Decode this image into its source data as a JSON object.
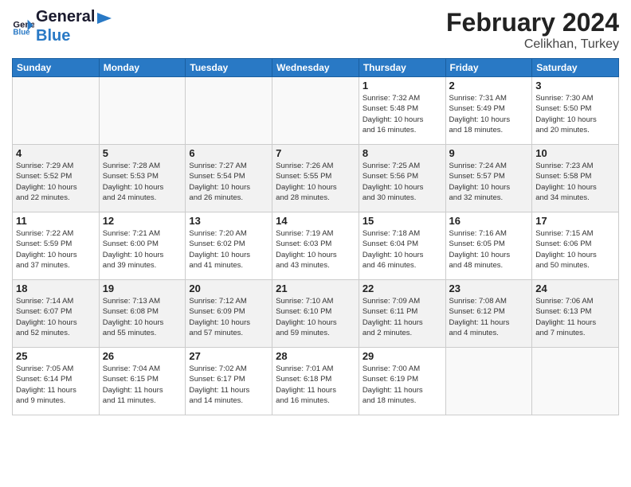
{
  "header": {
    "logo_text_general": "General",
    "logo_text_blue": "Blue",
    "month_title": "February 2024",
    "location": "Celikhan, Turkey"
  },
  "weekdays": [
    "Sunday",
    "Monday",
    "Tuesday",
    "Wednesday",
    "Thursday",
    "Friday",
    "Saturday"
  ],
  "weeks": [
    [
      {
        "day": "",
        "info": ""
      },
      {
        "day": "",
        "info": ""
      },
      {
        "day": "",
        "info": ""
      },
      {
        "day": "",
        "info": ""
      },
      {
        "day": "1",
        "info": "Sunrise: 7:32 AM\nSunset: 5:48 PM\nDaylight: 10 hours\nand 16 minutes."
      },
      {
        "day": "2",
        "info": "Sunrise: 7:31 AM\nSunset: 5:49 PM\nDaylight: 10 hours\nand 18 minutes."
      },
      {
        "day": "3",
        "info": "Sunrise: 7:30 AM\nSunset: 5:50 PM\nDaylight: 10 hours\nand 20 minutes."
      }
    ],
    [
      {
        "day": "4",
        "info": "Sunrise: 7:29 AM\nSunset: 5:52 PM\nDaylight: 10 hours\nand 22 minutes."
      },
      {
        "day": "5",
        "info": "Sunrise: 7:28 AM\nSunset: 5:53 PM\nDaylight: 10 hours\nand 24 minutes."
      },
      {
        "day": "6",
        "info": "Sunrise: 7:27 AM\nSunset: 5:54 PM\nDaylight: 10 hours\nand 26 minutes."
      },
      {
        "day": "7",
        "info": "Sunrise: 7:26 AM\nSunset: 5:55 PM\nDaylight: 10 hours\nand 28 minutes."
      },
      {
        "day": "8",
        "info": "Sunrise: 7:25 AM\nSunset: 5:56 PM\nDaylight: 10 hours\nand 30 minutes."
      },
      {
        "day": "9",
        "info": "Sunrise: 7:24 AM\nSunset: 5:57 PM\nDaylight: 10 hours\nand 32 minutes."
      },
      {
        "day": "10",
        "info": "Sunrise: 7:23 AM\nSunset: 5:58 PM\nDaylight: 10 hours\nand 34 minutes."
      }
    ],
    [
      {
        "day": "11",
        "info": "Sunrise: 7:22 AM\nSunset: 5:59 PM\nDaylight: 10 hours\nand 37 minutes."
      },
      {
        "day": "12",
        "info": "Sunrise: 7:21 AM\nSunset: 6:00 PM\nDaylight: 10 hours\nand 39 minutes."
      },
      {
        "day": "13",
        "info": "Sunrise: 7:20 AM\nSunset: 6:02 PM\nDaylight: 10 hours\nand 41 minutes."
      },
      {
        "day": "14",
        "info": "Sunrise: 7:19 AM\nSunset: 6:03 PM\nDaylight: 10 hours\nand 43 minutes."
      },
      {
        "day": "15",
        "info": "Sunrise: 7:18 AM\nSunset: 6:04 PM\nDaylight: 10 hours\nand 46 minutes."
      },
      {
        "day": "16",
        "info": "Sunrise: 7:16 AM\nSunset: 6:05 PM\nDaylight: 10 hours\nand 48 minutes."
      },
      {
        "day": "17",
        "info": "Sunrise: 7:15 AM\nSunset: 6:06 PM\nDaylight: 10 hours\nand 50 minutes."
      }
    ],
    [
      {
        "day": "18",
        "info": "Sunrise: 7:14 AM\nSunset: 6:07 PM\nDaylight: 10 hours\nand 52 minutes."
      },
      {
        "day": "19",
        "info": "Sunrise: 7:13 AM\nSunset: 6:08 PM\nDaylight: 10 hours\nand 55 minutes."
      },
      {
        "day": "20",
        "info": "Sunrise: 7:12 AM\nSunset: 6:09 PM\nDaylight: 10 hours\nand 57 minutes."
      },
      {
        "day": "21",
        "info": "Sunrise: 7:10 AM\nSunset: 6:10 PM\nDaylight: 10 hours\nand 59 minutes."
      },
      {
        "day": "22",
        "info": "Sunrise: 7:09 AM\nSunset: 6:11 PM\nDaylight: 11 hours\nand 2 minutes."
      },
      {
        "day": "23",
        "info": "Sunrise: 7:08 AM\nSunset: 6:12 PM\nDaylight: 11 hours\nand 4 minutes."
      },
      {
        "day": "24",
        "info": "Sunrise: 7:06 AM\nSunset: 6:13 PM\nDaylight: 11 hours\nand 7 minutes."
      }
    ],
    [
      {
        "day": "25",
        "info": "Sunrise: 7:05 AM\nSunset: 6:14 PM\nDaylight: 11 hours\nand 9 minutes."
      },
      {
        "day": "26",
        "info": "Sunrise: 7:04 AM\nSunset: 6:15 PM\nDaylight: 11 hours\nand 11 minutes."
      },
      {
        "day": "27",
        "info": "Sunrise: 7:02 AM\nSunset: 6:17 PM\nDaylight: 11 hours\nand 14 minutes."
      },
      {
        "day": "28",
        "info": "Sunrise: 7:01 AM\nSunset: 6:18 PM\nDaylight: 11 hours\nand 16 minutes."
      },
      {
        "day": "29",
        "info": "Sunrise: 7:00 AM\nSunset: 6:19 PM\nDaylight: 11 hours\nand 18 minutes."
      },
      {
        "day": "",
        "info": ""
      },
      {
        "day": "",
        "info": ""
      }
    ]
  ]
}
